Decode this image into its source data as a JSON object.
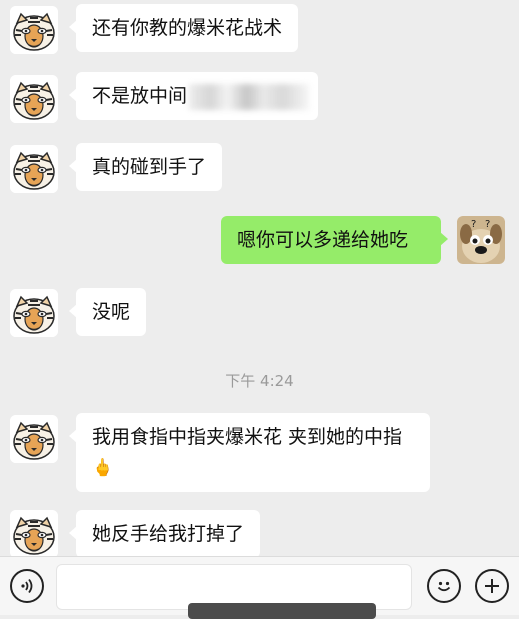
{
  "messages": [
    {
      "side": "left",
      "text": "还有你教的爆米花战术"
    },
    {
      "side": "left",
      "text": "不是放中间",
      "redacted": true
    },
    {
      "side": "left",
      "text": "真的碰到手了"
    },
    {
      "side": "right",
      "text": "嗯你可以多递给她吃"
    },
    {
      "side": "left",
      "text": "没呢"
    },
    {
      "side": "left",
      "text": "我用食指中指夹爆米花 夹到她的中指",
      "emoji": "🖕"
    },
    {
      "side": "left",
      "text": "她反手给我打掉了"
    }
  ],
  "timestamp": "下午 4:24",
  "input_bar": {
    "value": ""
  },
  "icons": {
    "left_avatar": "tiger-avatar-icon",
    "right_avatar": "dog-avatar-icon",
    "voice": "voice-icon",
    "emoji": "emoji-icon",
    "add": "add-icon"
  },
  "colors": {
    "background": "#ededed",
    "sent_bubble": "#95ec69",
    "received_bubble": "#ffffff"
  }
}
